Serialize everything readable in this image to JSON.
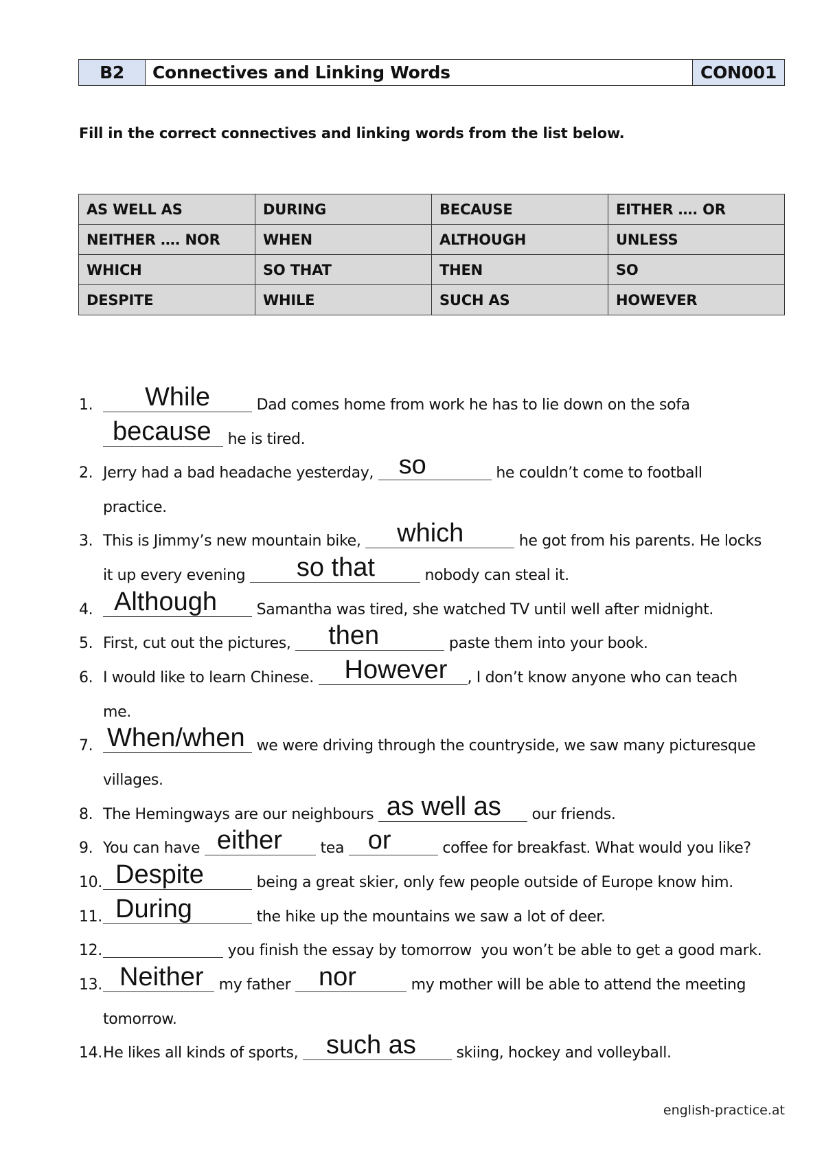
{
  "header": {
    "level": "B2",
    "title": "Connectives and Linking Words",
    "code": "CON001"
  },
  "instructions": "Fill in the correct connectives and linking words from the list below.",
  "word_box": {
    "rows": [
      [
        "AS WELL AS",
        "DURING",
        "BECAUSE",
        "EITHER …. OR"
      ],
      [
        "NEITHER …. NOR",
        "WHEN",
        "ALTHOUGH",
        "UNLESS"
      ],
      [
        "WHICH",
        "SO THAT",
        "THEN",
        "SO"
      ],
      [
        "DESPITE",
        "WHILE",
        "SUCH AS",
        "HOWEVER"
      ]
    ]
  },
  "exercises": [
    {
      "number": "1.",
      "lines": [
        [
          {
            "blank": "While"
          },
          {
            "text": " Dad comes home from work he has to lie down on the sofa"
          }
        ],
        [
          {
            "blank": "because"
          },
          {
            "text": " he is tired."
          }
        ]
      ]
    },
    {
      "number": "2.",
      "lines": [
        [
          {
            "text": "Jerry had a bad headache yesterday, "
          },
          {
            "blank": "so"
          },
          {
            "text": " he couldn’t come to football"
          }
        ],
        [
          {
            "text": "practice."
          }
        ]
      ]
    },
    {
      "number": "3.",
      "lines": [
        [
          {
            "text": "This is Jimmy’s new mountain bike, "
          },
          {
            "blank": "which"
          },
          {
            "text": " he got from his parents. He locks"
          }
        ],
        [
          {
            "text": "it up every evening "
          },
          {
            "blank": "so that"
          },
          {
            "text": " nobody can steal it."
          }
        ]
      ]
    },
    {
      "number": "4.",
      "lines": [
        [
          {
            "blank": "Although"
          },
          {
            "text": " Samantha was tired, she watched TV until well after midnight."
          }
        ]
      ]
    },
    {
      "number": "5.",
      "lines": [
        [
          {
            "text": "First, cut out the pictures, "
          },
          {
            "blank": "then"
          },
          {
            "text": " paste them into your book."
          }
        ]
      ]
    },
    {
      "number": "6.",
      "lines": [
        [
          {
            "text": "I would like to learn Chinese. "
          },
          {
            "blank": "However"
          },
          {
            "text": ", I don’t know anyone who can teach"
          }
        ],
        [
          {
            "text": "me."
          }
        ]
      ]
    },
    {
      "number": "7.",
      "lines": [
        [
          {
            "blank": "When/when"
          },
          {
            "text": " we were driving through the countryside, we saw many picturesque"
          }
        ],
        [
          {
            "text": "villages."
          }
        ]
      ]
    },
    {
      "number": "8.",
      "lines": [
        [
          {
            "text": "The Hemingways are our neighbours "
          },
          {
            "blank": "as well as"
          },
          {
            "text": " our friends."
          }
        ]
      ]
    },
    {
      "number": "9.",
      "lines": [
        [
          {
            "text": "You can have "
          },
          {
            "blank": "either"
          },
          {
            "text": " tea "
          },
          {
            "blank": "or"
          },
          {
            "text": " coffee for breakfast. What would you like?"
          }
        ]
      ]
    },
    {
      "number": "10.",
      "lines": [
        [
          {
            "blank": "Despite"
          },
          {
            "text": " being a great skier, only few people outside of Europe know him."
          }
        ]
      ]
    },
    {
      "number": "11.",
      "lines": [
        [
          {
            "blank": "During"
          },
          {
            "text": " the hike up the mountains we saw a lot of deer."
          }
        ]
      ]
    },
    {
      "number": "12.",
      "lines": [
        [
          {
            "blank": ""
          },
          {
            "text": " you finish the essay by tomorrow  you won’t be able to get a good mark."
          }
        ]
      ]
    },
    {
      "number": "13.",
      "lines": [
        [
          {
            "blank": "Neither"
          },
          {
            "text": " my father "
          },
          {
            "blank": "nor"
          },
          {
            "text": " my mother will be able to attend the meeting"
          }
        ],
        [
          {
            "text": "tomorrow."
          }
        ]
      ]
    },
    {
      "number": "14.",
      "lines": [
        [
          {
            "text": "He likes all kinds of sports, "
          },
          {
            "blank": "such as"
          },
          {
            "text": " skiing, hockey and volleyball."
          }
        ]
      ]
    }
  ],
  "footer": "english-practice.at"
}
